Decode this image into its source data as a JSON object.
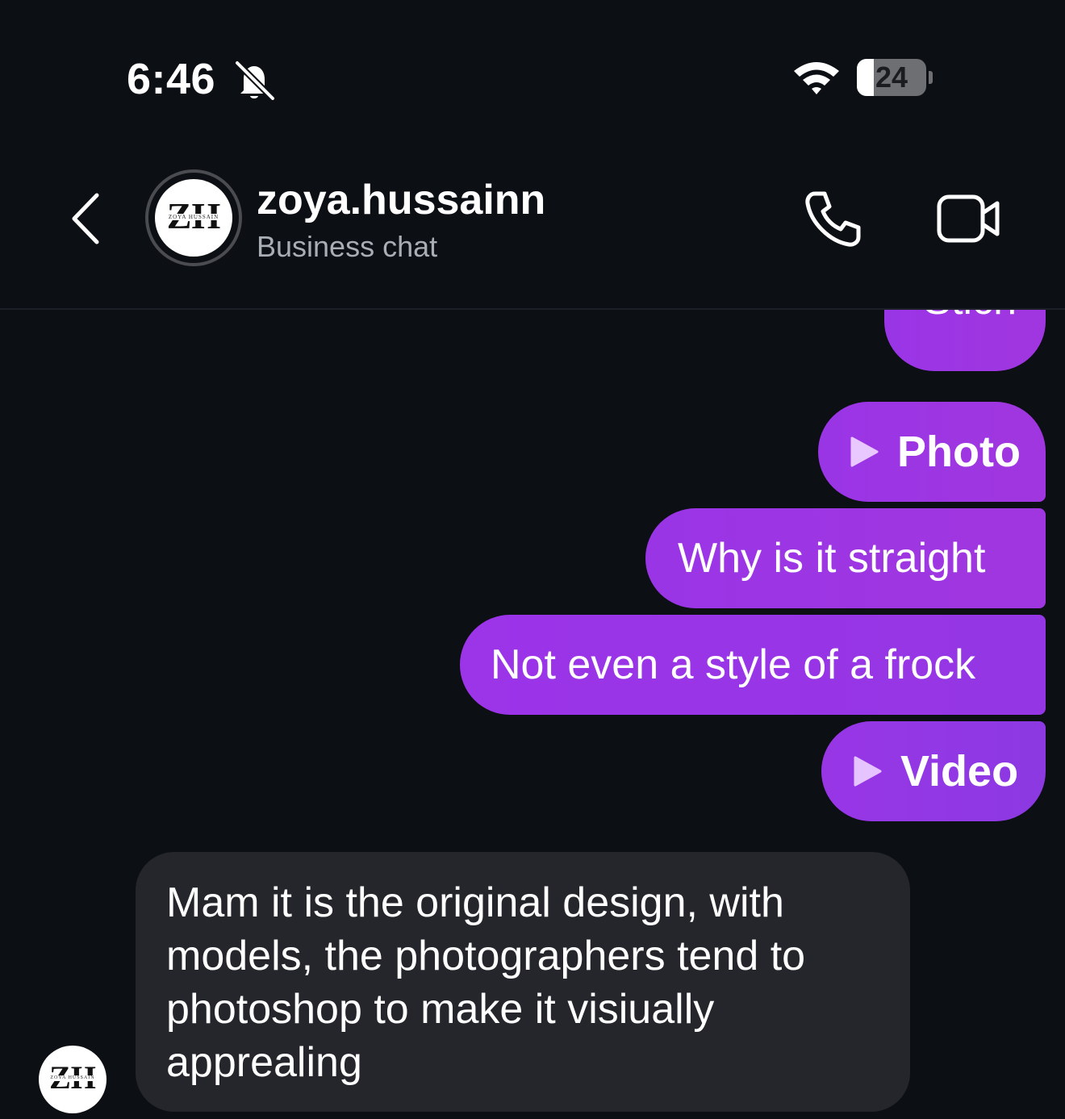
{
  "status_bar": {
    "time": "6:46",
    "silent_icon": "bell-slash-icon",
    "wifi_icon": "wifi-icon",
    "battery_level": "24",
    "battery_fraction": 0.24
  },
  "header": {
    "back_icon": "chevron-left-icon",
    "avatar": {
      "monogram": "ZH",
      "caption": "ZOYA HUSSAIN"
    },
    "username": "zoya.hussainn",
    "subtitle": "Business chat",
    "call_icon": "phone-icon",
    "video_icon": "video-camera-icon"
  },
  "messages": [
    {
      "direction": "outgoing",
      "type": "text",
      "text": "Stich"
    },
    {
      "direction": "outgoing",
      "type": "media",
      "icon": "play-icon",
      "label": "Photo"
    },
    {
      "direction": "outgoing",
      "type": "text",
      "text": "Why is it straight"
    },
    {
      "direction": "outgoing",
      "type": "text",
      "text": "Not even a style of a frock"
    },
    {
      "direction": "outgoing",
      "type": "media",
      "icon": "play-icon",
      "label": "Video"
    },
    {
      "direction": "incoming",
      "type": "text",
      "lines": [
        "Mam it is the original design, with",
        "models, the photographers tend to",
        "photoshop to make it visiually",
        "apprealing"
      ]
    }
  ],
  "colors": {
    "background": "#0c0f14",
    "outgoing_bubble": "#9a35e6",
    "incoming_bubble": "#24262c",
    "secondary_text": "#a9adb4"
  }
}
